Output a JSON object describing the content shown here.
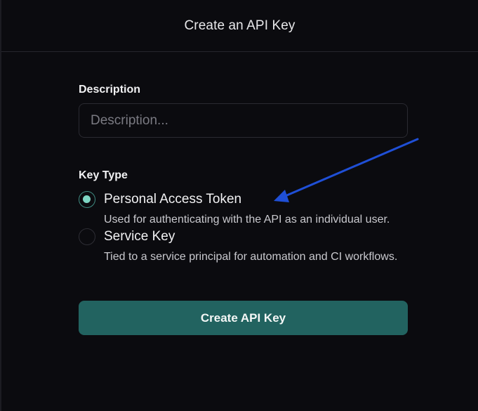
{
  "dialog": {
    "title": "Create an API Key"
  },
  "form": {
    "description_label": "Description",
    "description_placeholder": "Description...",
    "description_value": "",
    "key_type_label": "Key Type",
    "options": [
      {
        "title": "Personal Access Token",
        "description": "Used for authenticating with the API as an individual user.",
        "selected": true
      },
      {
        "title": "Service Key",
        "description": "Tied to a service principal for automation and CI workflows.",
        "selected": false
      }
    ],
    "submit_label": "Create API Key"
  },
  "colors": {
    "accent": "#226360",
    "radio_selected": "#7ed6c4",
    "annotation_arrow": "#1f4fd6",
    "background": "#0b0b0f"
  },
  "icons": {
    "annotation": "arrow-pointer-icon"
  }
}
